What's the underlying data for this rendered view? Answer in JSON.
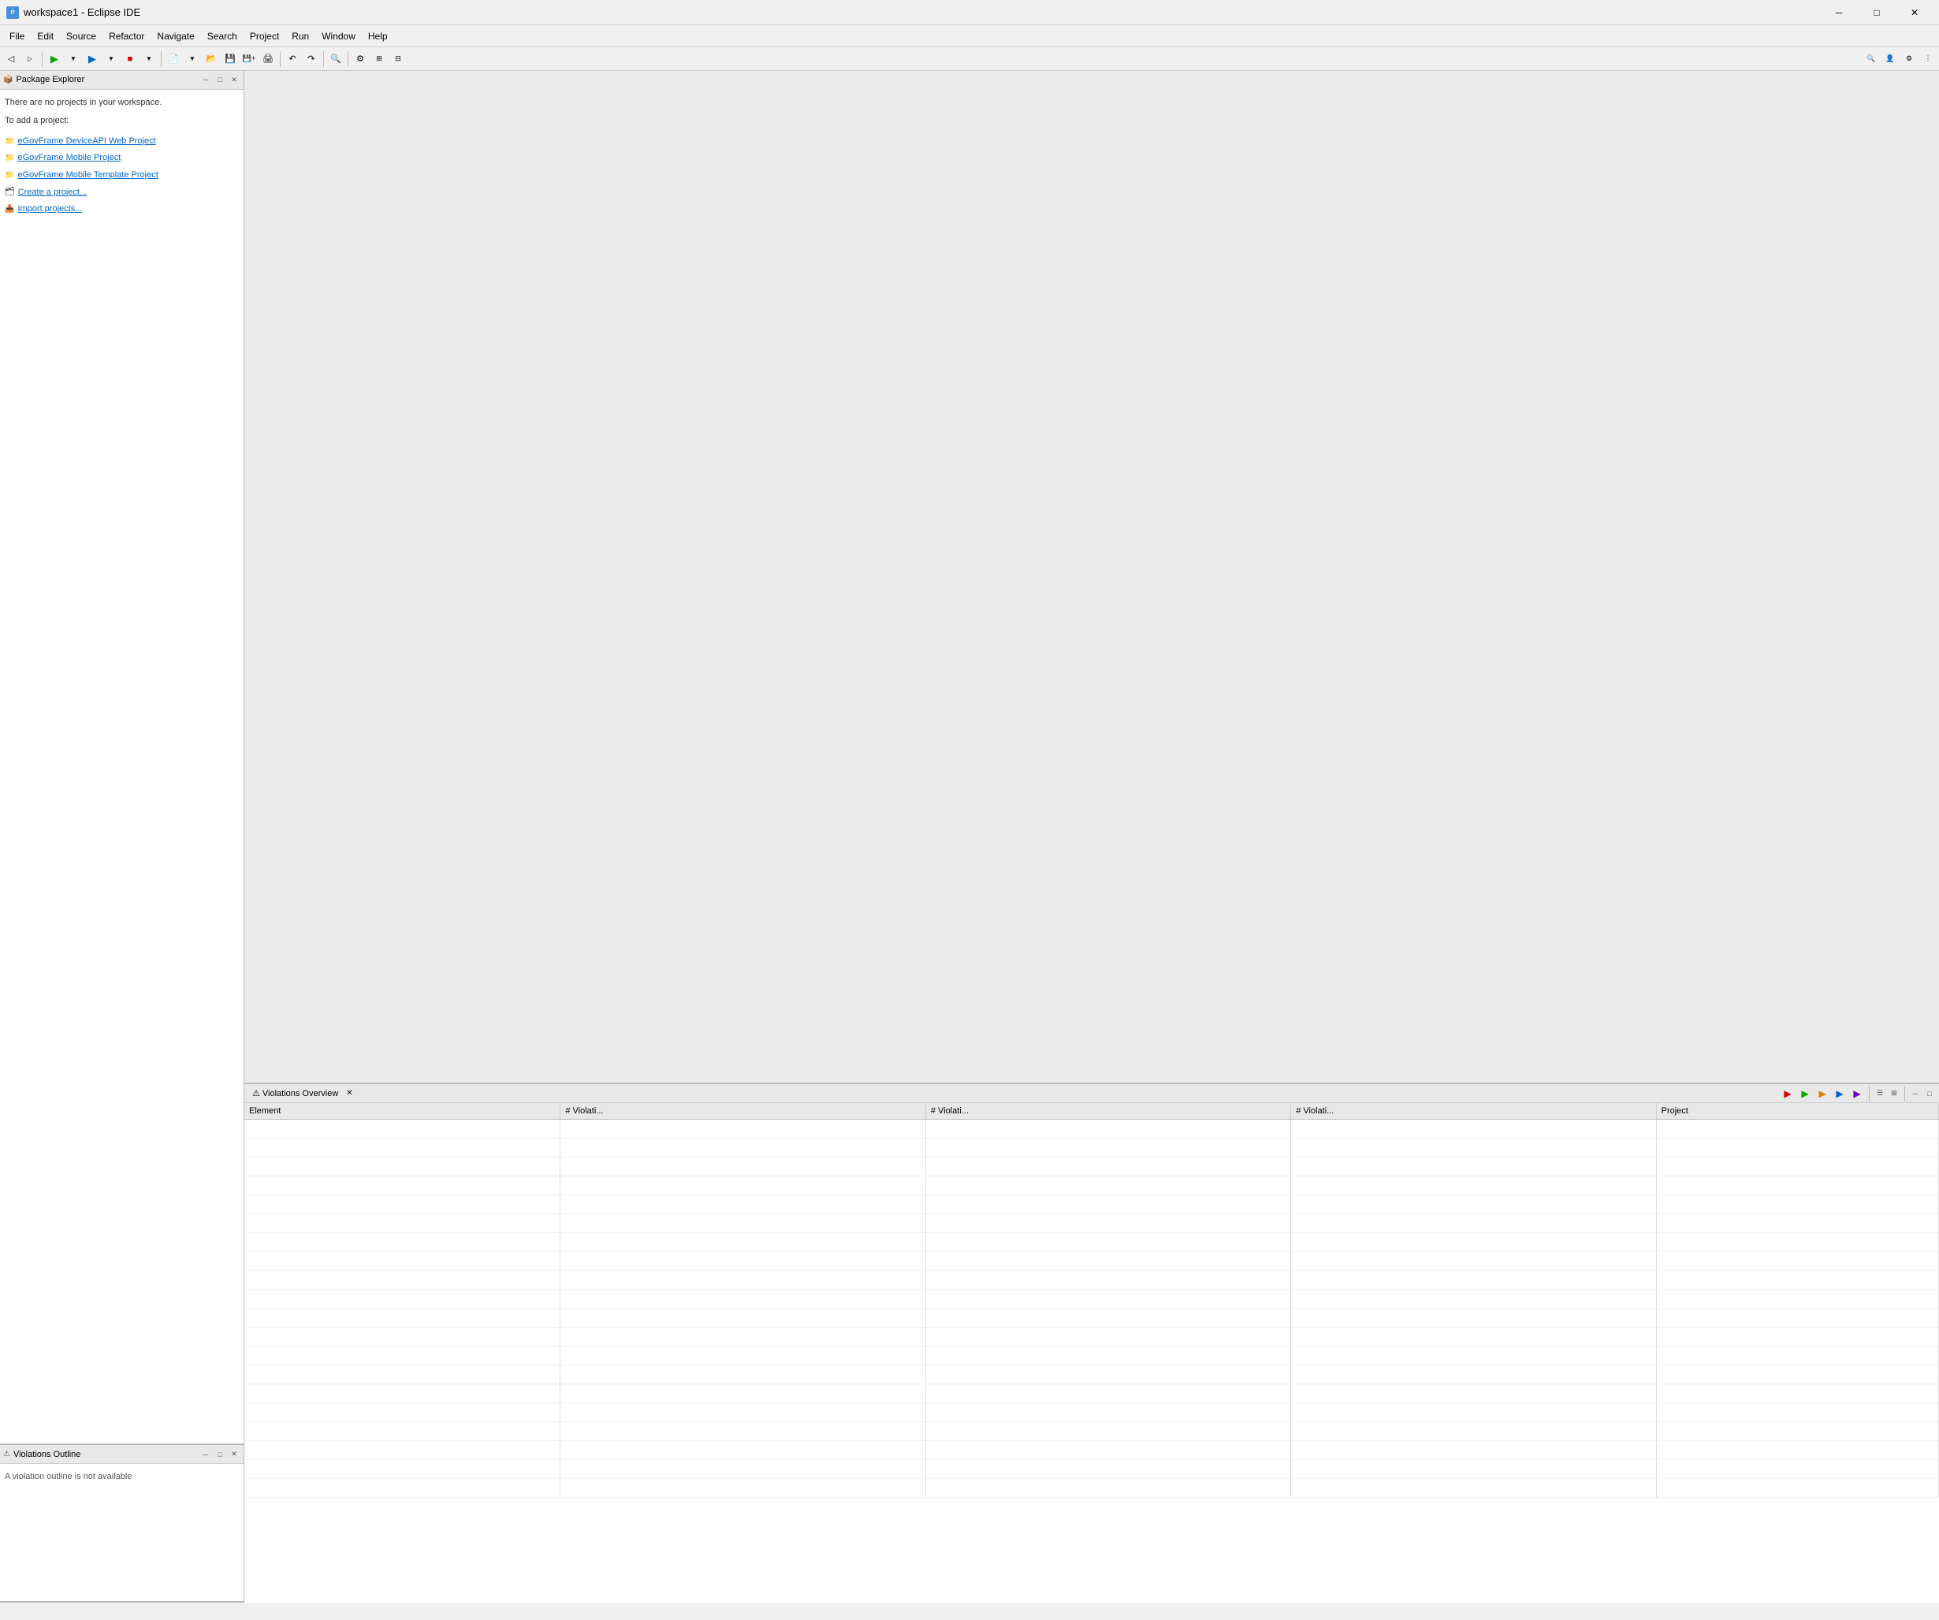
{
  "titleBar": {
    "icon": "e",
    "title": "workspace1 - Eclipse IDE",
    "minimizeLabel": "─",
    "maximizeLabel": "□",
    "closeLabel": "✕"
  },
  "menuBar": {
    "items": [
      {
        "label": "File",
        "id": "file"
      },
      {
        "label": "Edit",
        "id": "edit"
      },
      {
        "label": "Source",
        "id": "source"
      },
      {
        "label": "Refactor",
        "id": "refactor"
      },
      {
        "label": "Navigate",
        "id": "navigate"
      },
      {
        "label": "Search",
        "id": "search"
      },
      {
        "label": "Project",
        "id": "project"
      },
      {
        "label": "Run",
        "id": "run"
      },
      {
        "label": "Window",
        "id": "window"
      },
      {
        "label": "Help",
        "id": "help"
      }
    ]
  },
  "packageExplorer": {
    "title": "Package Explorer",
    "noProjectsMsg1": "There are no projects in your workspace.",
    "noProjectsMsg2": "To add a project:",
    "links": [
      {
        "label": "eGovFrame DeviceAPI Web Project",
        "id": "link1"
      },
      {
        "label": "eGovFrame Mobile Project",
        "id": "link2"
      },
      {
        "label": "eGovFrame Mobile Template Project",
        "id": "link3"
      },
      {
        "label": "Create a project...",
        "id": "link4"
      },
      {
        "label": "Import projects...",
        "id": "link5"
      }
    ]
  },
  "violationsOutline": {
    "title": "Violations Outline",
    "message": "A violation outline is not available"
  },
  "violationsOverview": {
    "title": "Violations Overview",
    "table": {
      "columns": [
        {
          "label": "Element",
          "id": "element"
        },
        {
          "label": "# Violati...",
          "id": "violations1"
        },
        {
          "label": "# Violati...",
          "id": "violations2"
        },
        {
          "label": "# Violati...",
          "id": "violations3"
        },
        {
          "label": "Project",
          "id": "project"
        }
      ],
      "rows": []
    }
  },
  "toolbar": {
    "buttons": [
      "◀",
      "◀",
      "◀▶",
      "▶",
      "▶▶",
      "⬛",
      "⬛⬛",
      "↺",
      "❌",
      "⚙",
      "🔧",
      "📄",
      "📂",
      "💾",
      "🖨",
      "↶",
      "↷",
      "🔍",
      "🔍+",
      "🔍-"
    ]
  },
  "colors": {
    "accent": "#4a90d9",
    "link": "#0066cc",
    "background": "#f0f0f0",
    "panelBg": "#ffffff",
    "headerBg": "#e8e8e8"
  }
}
